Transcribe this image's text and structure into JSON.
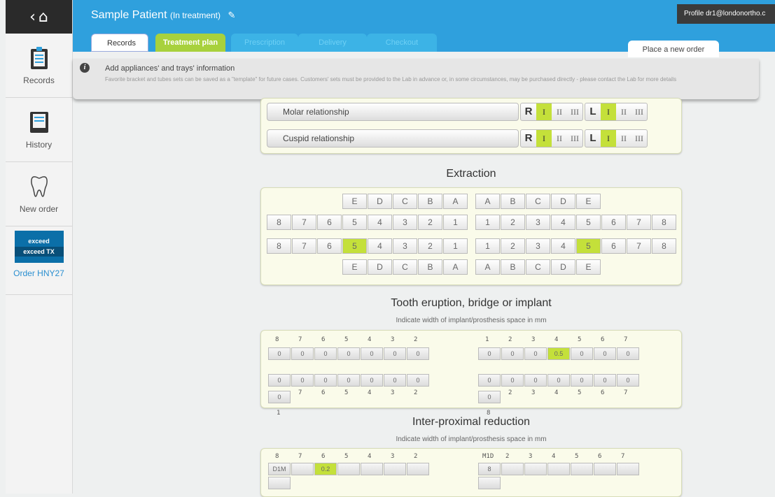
{
  "sidebar": {
    "items": [
      {
        "label": "Records"
      },
      {
        "label": "History"
      },
      {
        "label": "New order"
      }
    ],
    "promo": {
      "line1": "exceed",
      "line2": "exceed TX"
    },
    "order_code": "Order HNY27"
  },
  "header": {
    "patient": "Sample Patient",
    "status": "(In treatment)",
    "profile": "Profile  dr1@londonortho.c",
    "tabs": [
      "Records",
      "Treatment plan",
      "Prescription",
      "Delivery",
      "Checkout"
    ],
    "active_tab": "Treatment plan",
    "new_order": "Place a new order"
  },
  "info": {
    "title": "Add appliances' and trays' information",
    "text": "Favorite bracket and tubes sets can be saved as a \"template\" for future cases. Customers' sets must be provided to the Lab in advance or, in some circumstances, may be purchased directly - please contact the Lab for more details"
  },
  "relationships": [
    {
      "label": "Molar relationship",
      "right": "II",
      "left": "I"
    },
    {
      "label": "Cuspid relationship",
      "right": "I",
      "left": "I"
    }
  ],
  "relationship_side_labels": [
    "R",
    "L"
  ],
  "relationship_classes": [
    "I",
    "II",
    "III"
  ],
  "extraction": {
    "title": "Extraction",
    "top_primary_right": [
      "E",
      "D",
      "C",
      "B",
      "A"
    ],
    "top_primary_left": [
      "A",
      "B",
      "C",
      "D",
      "E"
    ],
    "upper_right": [
      "8",
      "7",
      "6",
      "5",
      "4",
      "3",
      "2",
      "1"
    ],
    "upper_left": [
      "1",
      "2",
      "3",
      "4",
      "5",
      "6",
      "7",
      "8"
    ],
    "lower_right": [
      "8",
      "7",
      "6",
      "5",
      "4",
      "3",
      "2",
      "1"
    ],
    "lower_left": [
      "1",
      "2",
      "3",
      "4",
      "5",
      "6",
      "7",
      "8"
    ],
    "bottom_primary_right": [
      "E",
      "D",
      "C",
      "B",
      "A"
    ],
    "bottom_primary_left": [
      "A",
      "B",
      "C",
      "D",
      "E"
    ]
  },
  "eruption": {
    "title": "Tooth eruption, bridge or implant",
    "subtitle": "Indicate width of implant/prosthesis space in mm",
    "right_nums": [
      "8",
      "7",
      "6",
      "5",
      "4",
      "3",
      "2"
    ],
    "left_nums": [
      "1",
      "2",
      "3",
      "4",
      "5",
      "6",
      "7"
    ],
    "upper_right": [
      "0",
      "0",
      "0",
      "0",
      "0",
      "0",
      "0"
    ],
    "upper_left": [
      "0",
      "0",
      "0",
      "0.5",
      "0",
      "0",
      "0"
    ],
    "lower_right": [
      "0",
      "0",
      "0",
      "0",
      "0",
      "0",
      "0"
    ],
    "lower_left": [
      "0",
      "0",
      "0",
      "0",
      "0",
      "0",
      "0"
    ],
    "lower_right_nums": [
      "7",
      "6",
      "5",
      "4",
      "3",
      "2"
    ],
    "lower_left_nums": [
      "2",
      "3",
      "4",
      "5",
      "6",
      "7"
    ],
    "tail_right": "1",
    "tail_left": "8"
  },
  "ipr": {
    "title": "Inter-proximal reduction",
    "subtitle": "Indicate width of implant/prosthesis space in mm",
    "right_nums": [
      "8",
      "7",
      "6",
      "5",
      "4",
      "3",
      "2"
    ],
    "left_nums": [
      "M1D",
      "2",
      "3",
      "4",
      "5",
      "6",
      "7"
    ],
    "right_prefix": "D1M",
    "left_prefix": "8",
    "value": "0.2"
  }
}
